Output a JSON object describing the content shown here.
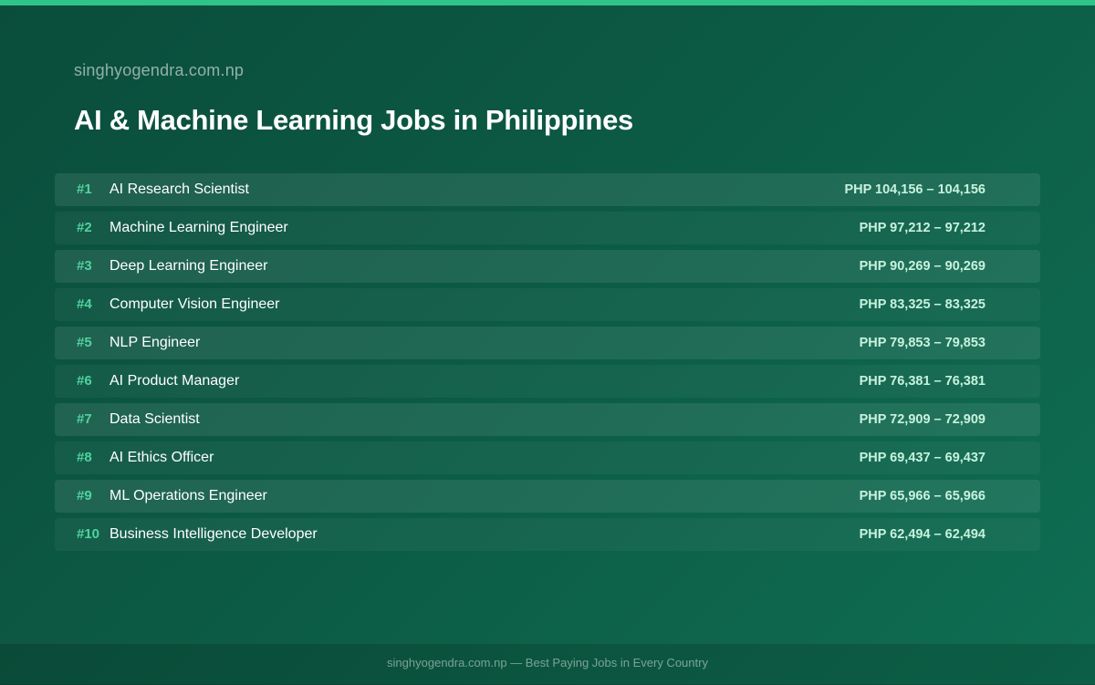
{
  "colors": {
    "accent": "#2fc489",
    "rank": "#4fd39d",
    "salary": "#c7f2de",
    "background_start": "#0a4d3b",
    "background_end": "#0f6e52"
  },
  "header": {
    "site_name": "singhyogendra.com.np",
    "title": "AI & Machine Learning Jobs in Philippines"
  },
  "jobs": [
    {
      "rank": "#1",
      "title": "AI Research Scientist",
      "salary": "PHP 104,156 – 104,156"
    },
    {
      "rank": "#2",
      "title": "Machine Learning Engineer",
      "salary": "PHP 97,212 – 97,212"
    },
    {
      "rank": "#3",
      "title": "Deep Learning Engineer",
      "salary": "PHP 90,269 – 90,269"
    },
    {
      "rank": "#4",
      "title": "Computer Vision Engineer",
      "salary": "PHP 83,325 – 83,325"
    },
    {
      "rank": "#5",
      "title": "NLP Engineer",
      "salary": "PHP 79,853 – 79,853"
    },
    {
      "rank": "#6",
      "title": "AI Product Manager",
      "salary": "PHP 76,381 – 76,381"
    },
    {
      "rank": "#7",
      "title": "Data Scientist",
      "salary": "PHP 72,909 – 72,909"
    },
    {
      "rank": "#8",
      "title": "AI Ethics Officer",
      "salary": "PHP 69,437 – 69,437"
    },
    {
      "rank": "#9",
      "title": "ML Operations Engineer",
      "salary": "PHP 65,966 – 65,966"
    },
    {
      "rank": "#10",
      "title": "Business Intelligence Developer",
      "salary": "PHP 62,494 – 62,494"
    }
  ],
  "footer": {
    "text": "singhyogendra.com.np — Best Paying Jobs in Every Country"
  }
}
